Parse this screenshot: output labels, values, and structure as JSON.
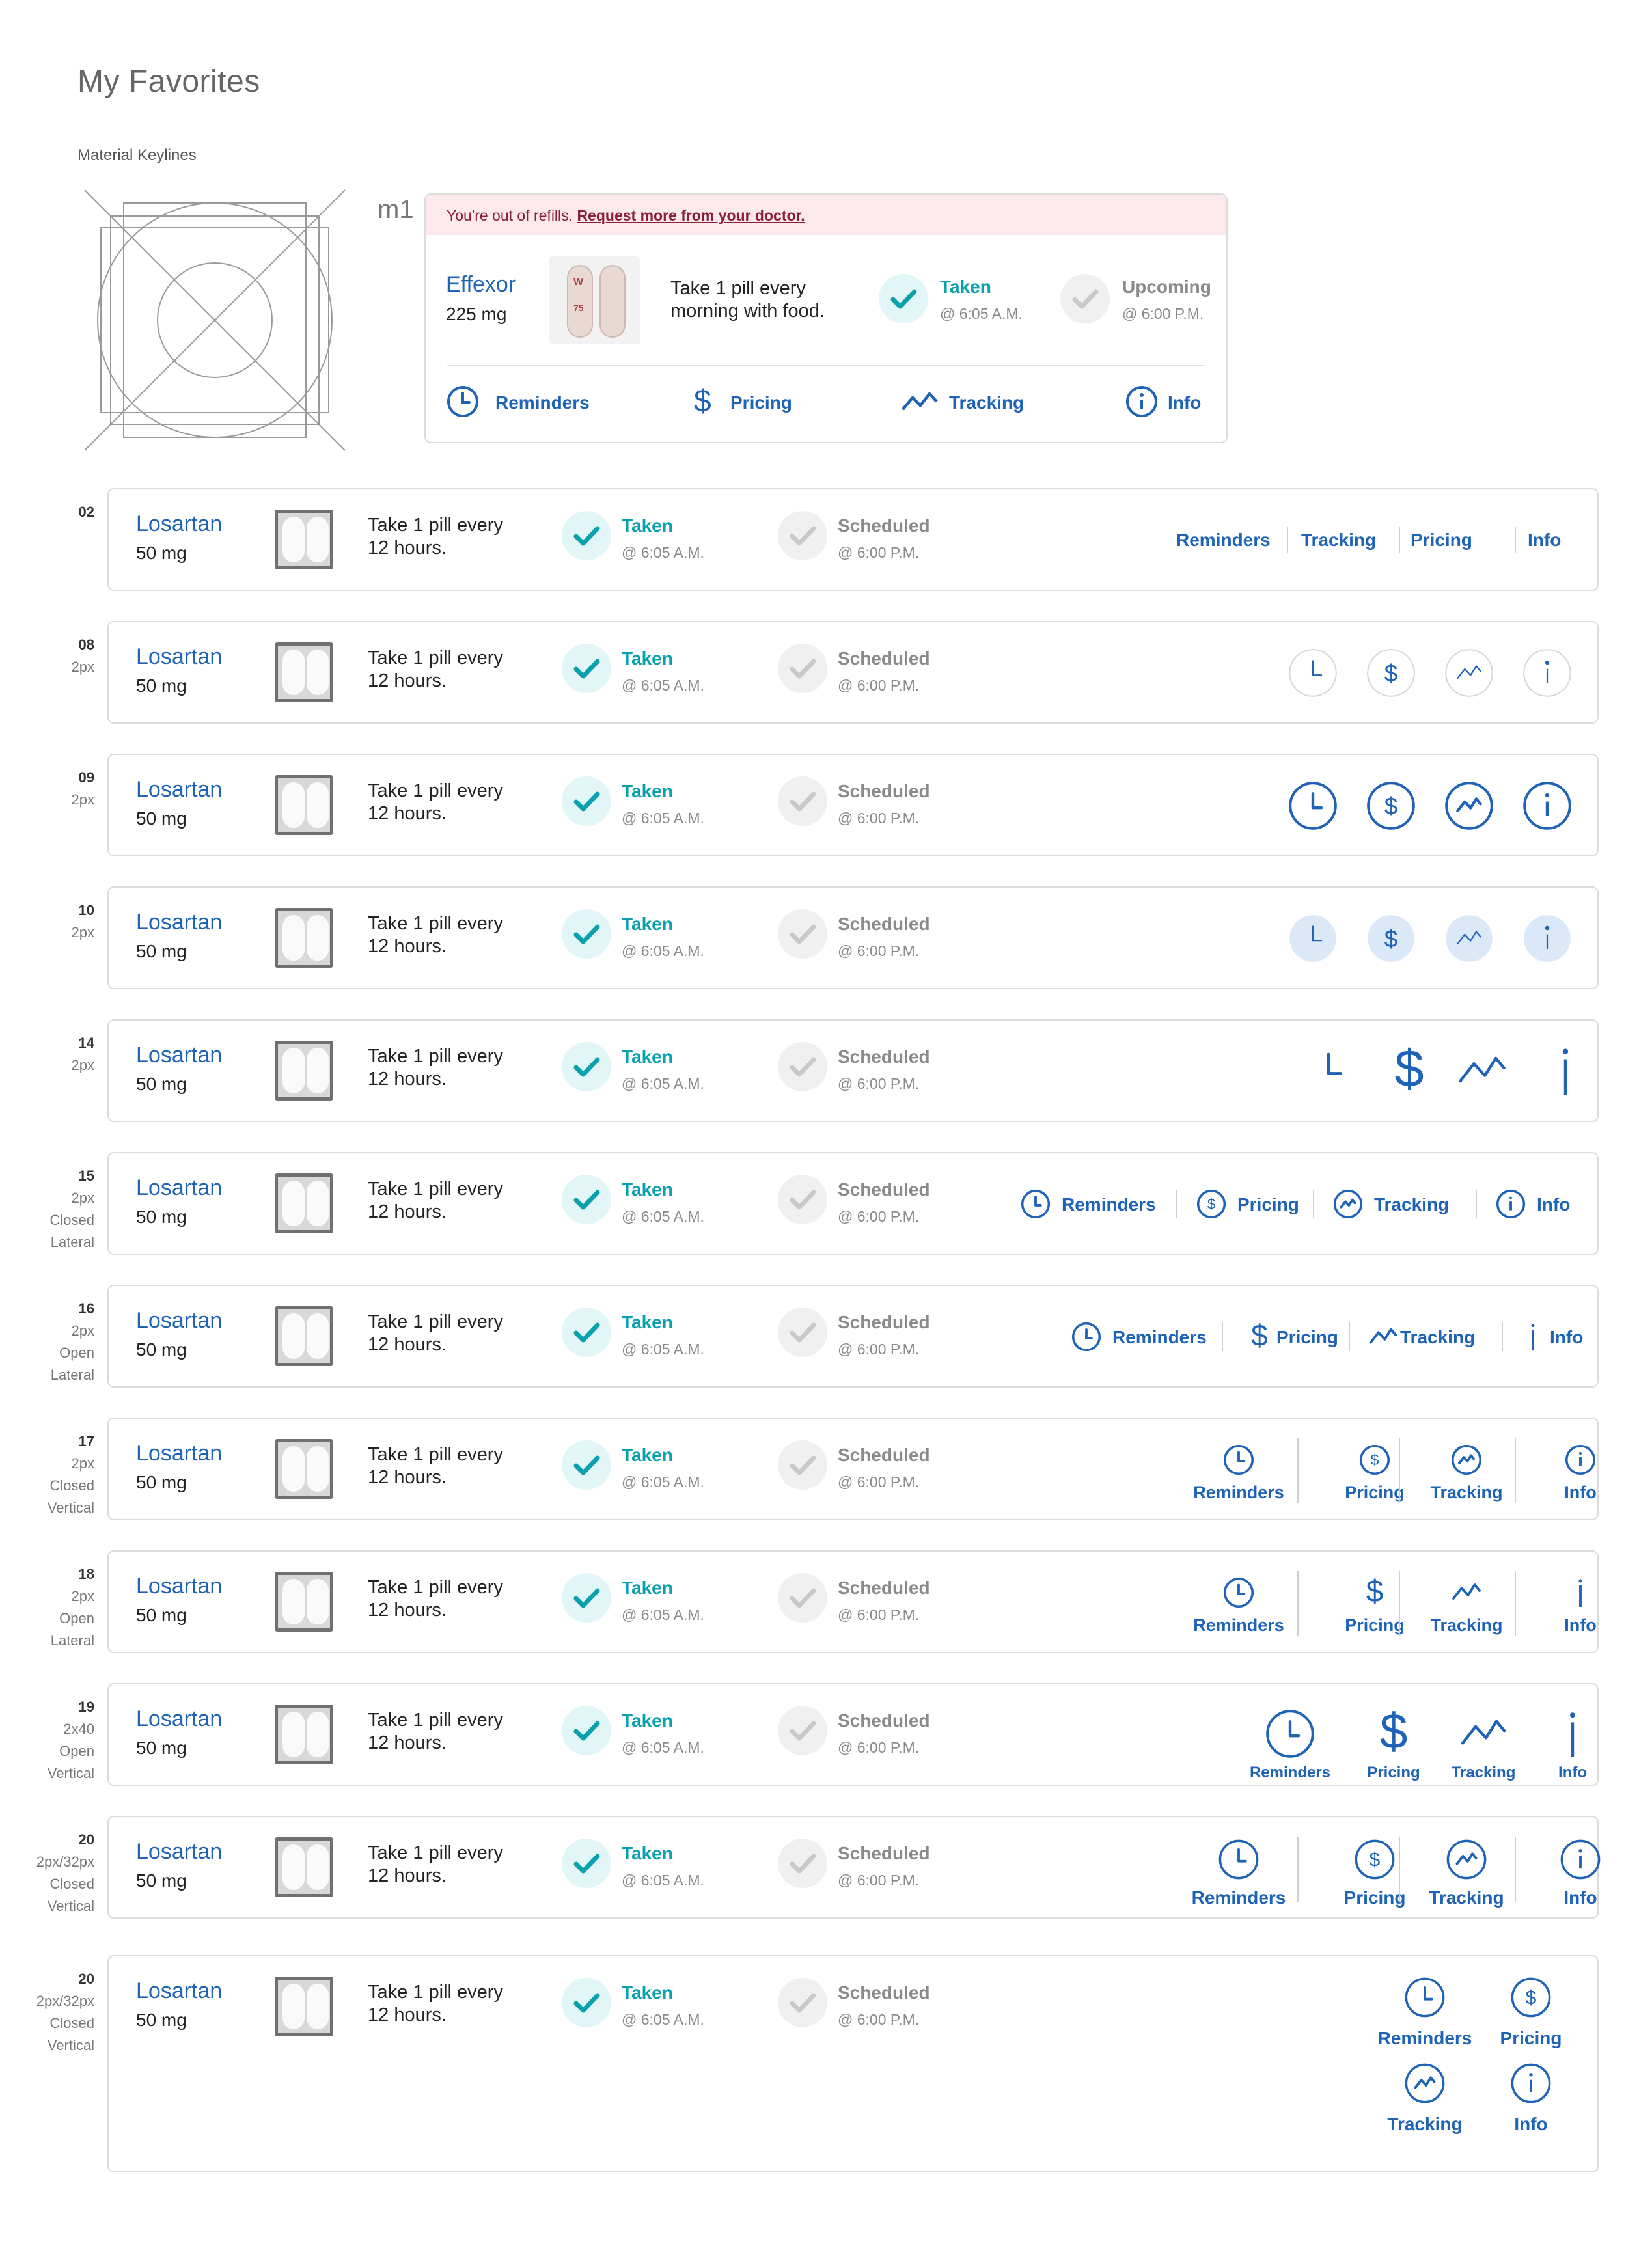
{
  "page": {
    "title": "My Favorites",
    "subtitle": "Material Keylines",
    "hero_label": "m1"
  },
  "hero": {
    "alert_text": "You're out of refills. ",
    "alert_link": "Request more from your doctor.",
    "med_name": "Effexor",
    "med_dose": "225 mg",
    "instr_line1": "Take 1 pill every",
    "instr_line2": "morning with food.",
    "taken_label": "Taken",
    "taken_time": "@ 6:05 A.M.",
    "upcoming_label": "Upcoming",
    "upcoming_time": "@ 6:00 P.M.",
    "actions": [
      "Reminders",
      "Pricing",
      "Tracking",
      "Info"
    ]
  },
  "row_common": {
    "med_name": "Losartan",
    "med_dose": "50 mg",
    "instr_line1": "Take 1 pill every",
    "instr_line2": "12 hours.",
    "taken_label": "Taken",
    "taken_time": "@ 6:05 A.M.",
    "scheduled_label": "Scheduled",
    "scheduled_time": "@ 6:00 P.M."
  },
  "actions": {
    "reminders": "Reminders",
    "tracking": "Tracking",
    "pricing": "Pricing",
    "info": "Info"
  },
  "rows": [
    {
      "num": "02",
      "meta": []
    },
    {
      "num": "08",
      "meta": [
        "2px"
      ]
    },
    {
      "num": "09",
      "meta": [
        "2px"
      ]
    },
    {
      "num": "10",
      "meta": [
        "2px"
      ]
    },
    {
      "num": "14",
      "meta": [
        "2px"
      ]
    },
    {
      "num": "15",
      "meta": [
        "2px",
        "Closed",
        "Lateral"
      ]
    },
    {
      "num": "16",
      "meta": [
        "2px",
        "Open",
        "Lateral"
      ]
    },
    {
      "num": "17",
      "meta": [
        "2px",
        "Closed",
        "Vertical"
      ]
    },
    {
      "num": "18",
      "meta": [
        "2px",
        "Open",
        "Lateral"
      ]
    },
    {
      "num": "19",
      "meta": [
        "2x40",
        "Open",
        "Vertical"
      ]
    },
    {
      "num": "20",
      "meta": [
        "2px/32px",
        "Closed",
        "Vertical"
      ]
    },
    {
      "num": "20",
      "meta": [
        "2px/32px",
        "Closed",
        "Vertical"
      ]
    }
  ],
  "icons": [
    "clock-icon",
    "dollar-icon",
    "trend-icon",
    "info-icon",
    "check-icon",
    "pill-icon"
  ],
  "colors": {
    "brand_blue": "#1e63b6",
    "teal": "#0aa0ad",
    "alert_bg": "#fbe9ec",
    "alert_text": "#8a1f3c",
    "muted": "#8a8a8a"
  }
}
